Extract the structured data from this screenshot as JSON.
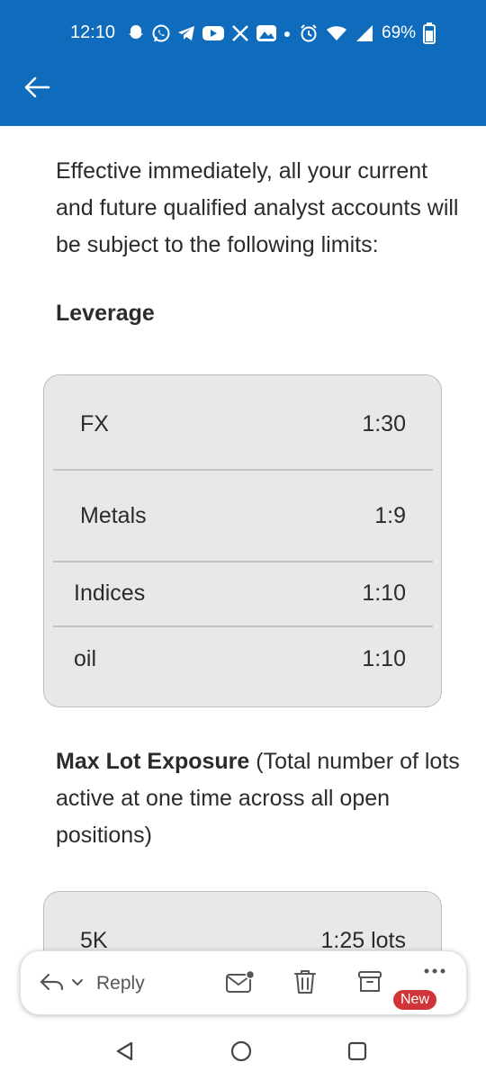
{
  "status_bar": {
    "time": "12:10",
    "battery": "69%",
    "notification_icons": [
      "snapchat-icon",
      "whatsapp-icon",
      "telegram-icon",
      "youtube-icon",
      "x-icon",
      "photos-icon",
      "dot-icon"
    ],
    "system_icons": [
      "alarm-icon",
      "wifi-icon",
      "signal-icon",
      "battery-icon"
    ]
  },
  "header": {
    "back_icon": "arrow-left-icon",
    "accent": "#0f6cbd"
  },
  "email": {
    "intro": "Effective immediately, all your current and future qualified analyst accounts will be subject to the following limits:",
    "leverage_heading": "Leverage",
    "leverage_rows": [
      {
        "label": "FX",
        "value": "1:30"
      },
      {
        "label": "Metals",
        "value": "1:9"
      },
      {
        "label": "Indices",
        "value": "1:10"
      },
      {
        "label": "oil",
        "value": "1:10"
      }
    ],
    "maxlot_heading_bold": "Max Lot Exposure",
    "maxlot_heading_rest": " (Total number of lots active at one time across all open positions)",
    "maxlot_rows": [
      {
        "label": "5K",
        "value": "1:25 lots"
      }
    ]
  },
  "action_bar": {
    "reply_label": "Reply",
    "new_badge": "New",
    "badge_color": "#d13438"
  }
}
